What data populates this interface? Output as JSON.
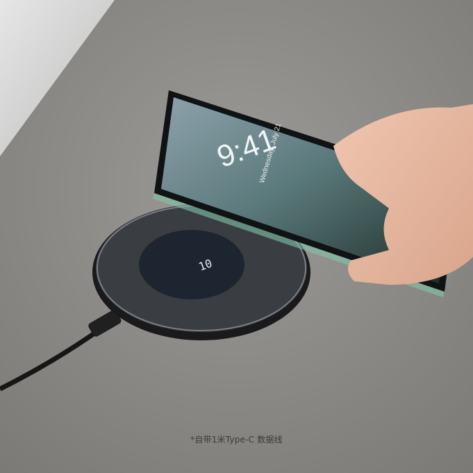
{
  "phone": {
    "time": "9:41",
    "date": "Wednesday, July 21"
  },
  "charger": {
    "display": "10"
  },
  "caption": "*自带1米Type-C 数据线",
  "colors": {
    "surface": "#8d8b88",
    "charger_center": "#1d2530",
    "caption": "#3a3a3a"
  }
}
